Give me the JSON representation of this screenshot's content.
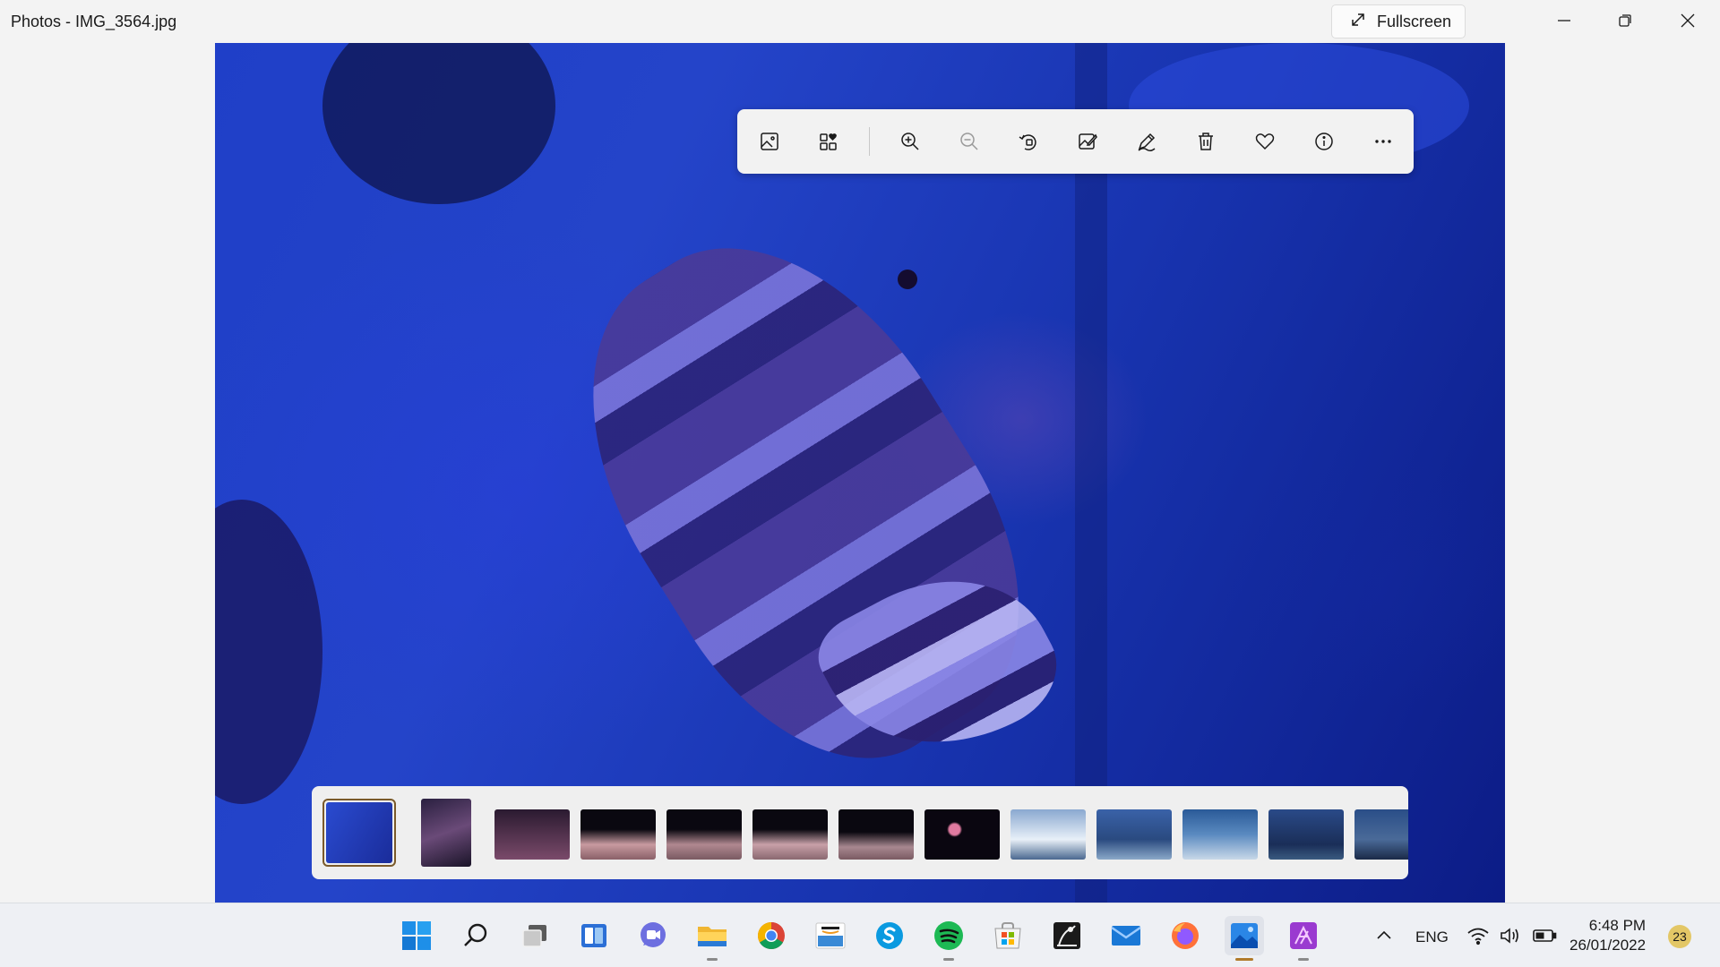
{
  "window": {
    "title": "Photos - IMG_3564.jpg",
    "fullscreen_label": "Fullscreen",
    "controls": [
      "minimize-icon",
      "restore-icon",
      "close-icon"
    ]
  },
  "toolbar": {
    "buttons": [
      "image-icon",
      "collections-icon",
      "zoom-in-icon",
      "zoom-out-icon",
      "rotate-icon",
      "edit-image-icon",
      "draw-icon",
      "delete-icon",
      "favorite-icon",
      "info-icon",
      "more-icon"
    ]
  },
  "filmstrip": {
    "selected_index": 0,
    "thumbnails": [
      {
        "color": "#3050c8"
      },
      {
        "color": "#3a2a50"
      },
      {
        "color": "#4a2e48"
      },
      {
        "color": "#6b4a52"
      },
      {
        "color": "#5a3a48"
      },
      {
        "color": "#6e4c58"
      },
      {
        "color": "#5e3c50"
      },
      {
        "color": "#1a1020"
      },
      {
        "color": "#a8c4dc"
      },
      {
        "color": "#3a5e9a"
      },
      {
        "color": "#2e5490"
      },
      {
        "color": "#243e70"
      },
      {
        "color": "#2a4e80"
      }
    ]
  },
  "taskbar": {
    "apps": [
      "windows-start-icon",
      "search-icon",
      "task-view-icon",
      "widgets-icon",
      "chat-icon",
      "file-explorer-icon",
      "chrome-icon",
      "amazon-icon",
      "skype-icon",
      "spotify-icon",
      "microsoft-store-icon",
      "kindle-icon",
      "mail-icon",
      "firefox-icon",
      "photos-icon",
      "affinity-icon"
    ],
    "language": "ENG",
    "time": "6:48 PM",
    "date": "26/01/2022",
    "notification_count": "23"
  }
}
